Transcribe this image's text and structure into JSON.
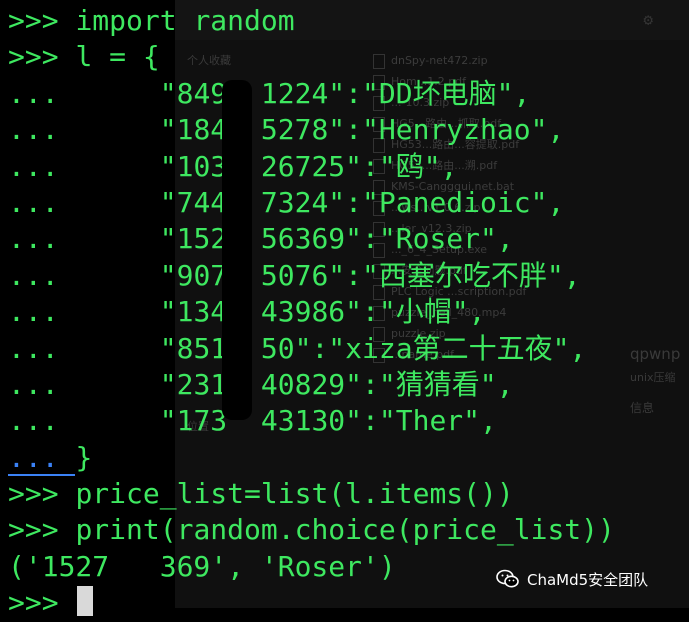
{
  "background_window": {
    "sidebar_heading": "个人收藏",
    "sidebar_location": "位置",
    "files": [
      "dnSpy-net472.zip",
      "Hom...1.2.pdf",
      "...-10.3.zip",
      "HG5...路由...抓取.pdf",
      "HG53...路由...容提取.pdf",
      "HG53...路由...溯.pdf",
      "KMS-Cangggui.net.bat",
      "...ws...v1.0.6.zip",
      "...ler_v12.3.zip",
      "..._6_4_Setup.exe",
      "...安全问题.pdf",
      "PLC Logic ...scription.pdf",
      "puzzle_hell_480.mp4",
      "puzzle.zip",
      "...name.pdf"
    ],
    "info_title": "qpwnp",
    "info_subtitle": "unix压缩",
    "info_label": "信息"
  },
  "terminal": {
    "lines": [
      {
        "prompt": ">>> ",
        "text": "import random"
      },
      {
        "prompt": ">>> ",
        "text": "l = {"
      },
      {
        "prompt": "... ",
        "text": "     \"849  1224\":\"DD坏电脑\","
      },
      {
        "prompt": "... ",
        "text": "     \"184  5278\":\"Henryzhao\","
      },
      {
        "prompt": "... ",
        "text": "     \"103  26725\":\"鸥\","
      },
      {
        "prompt": "... ",
        "text": "     \"744  7324\":\"Panedioic\","
      },
      {
        "prompt": "... ",
        "text": "     \"152  56369\":\"Roser\","
      },
      {
        "prompt": "... ",
        "text": "     \"907  5076\":\"西塞尔吃不胖\","
      },
      {
        "prompt": "... ",
        "text": "     \"134  43986\":\"小帽\","
      },
      {
        "prompt": "... ",
        "text": "     \"851  50\":\"xiza第二十五夜\","
      },
      {
        "prompt": "... ",
        "text": "     \"231  40829\":\"猜猜看\","
      },
      {
        "prompt": "... ",
        "text": "     \"173  43130\":\"Ther\","
      },
      {
        "prompt": "... ",
        "text": "}"
      },
      {
        "prompt": ">>> ",
        "text": "price_list=list(l.items())"
      },
      {
        "prompt": ">>> ",
        "text": "print(random.choice(price_list))"
      },
      {
        "prompt": "",
        "text": "('1527   369', 'Roser')"
      },
      {
        "prompt": ">>> ",
        "text": ""
      }
    ]
  },
  "watermark": {
    "text": "ChaMd5安全团队",
    "icon": "wechat-icon"
  },
  "colors": {
    "terminal_text": "#3ee860",
    "terminal_bg": "#000000",
    "continuation_highlight": "#3b82f6",
    "cursor": "#d9d9d9"
  }
}
